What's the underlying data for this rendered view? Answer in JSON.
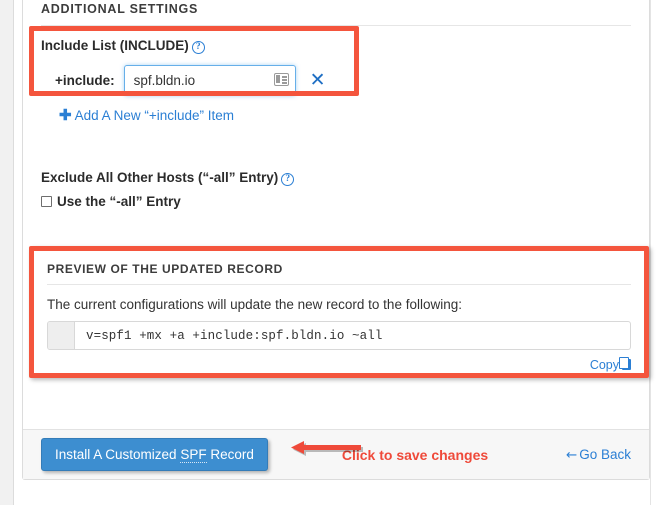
{
  "section": {
    "title": "ADDITIONAL SETTINGS"
  },
  "include": {
    "label": "Include List (INCLUDE)",
    "help_icon": "question-circle-icon",
    "inline_label": "+include:",
    "value": "spf.bldn.io",
    "placeholder": "",
    "field_icon": "address-book-icon",
    "remove_icon": "close-x-icon",
    "add_link": "Add A New “+include” Item",
    "add_icon": "plus-icon"
  },
  "exclude": {
    "label": "Exclude All Other Hosts (“-all” Entry)",
    "help_icon": "question-circle-icon",
    "checkbox_label": "Use the “-all” Entry",
    "checked": false
  },
  "preview": {
    "title": "PREVIEW OF THE UPDATED RECORD",
    "description": "The current configurations will update the new record to the following:",
    "record": "v=spf1 +mx +a +include:spf.bldn.io ~all",
    "copy_label": "Copy",
    "copy_icon": "copy-icon"
  },
  "footer": {
    "install_button": "Install A Customized SPF Record",
    "install_button_abbr": "SPF",
    "go_back": "Go Back",
    "go_back_icon": "arrow-left-icon"
  },
  "annotations": {
    "callout_text": "Click to save changes",
    "arrow_icon": "arrow-left-annotation-icon",
    "highlight_color": "#f4553d",
    "callout_color": "#ef4a3a"
  },
  "colors": {
    "primary_button": "#3d8ed0",
    "link": "#2b7fd4",
    "input_focus_border": "#66afe9"
  }
}
